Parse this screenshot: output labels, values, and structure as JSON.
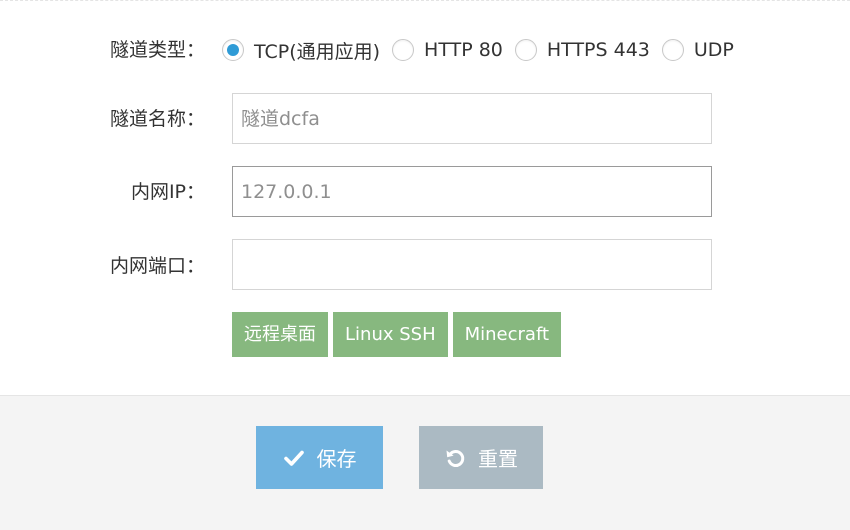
{
  "form": {
    "tunnel_type_label": "隧道类型：",
    "tunnel_types": [
      {
        "label": "TCP(通用应用)",
        "checked": true
      },
      {
        "label": "HTTP 80",
        "checked": false
      },
      {
        "label": "HTTPS 443",
        "checked": false
      },
      {
        "label": "UDP",
        "checked": false
      }
    ],
    "tunnel_name_label": "隧道名称：",
    "tunnel_name_placeholder": "隧道dcfa",
    "local_ip_label": "内网IP：",
    "local_ip_placeholder": "127.0.0.1",
    "local_port_label": "内网端口：",
    "local_port_placeholder": "",
    "presets": [
      "远程桌面",
      "Linux SSH",
      "Minecraft"
    ]
  },
  "actions": {
    "save_label": "保存",
    "reset_label": "重置"
  },
  "colors": {
    "radio_checked": "#2f9bd6",
    "preset_button": "#87b87f",
    "save_button": "#6fb3e0",
    "reset_button": "#abbac3",
    "footer_bg": "#f4f4f4"
  },
  "icons": {
    "save": "check-icon",
    "reset": "undo-icon"
  }
}
